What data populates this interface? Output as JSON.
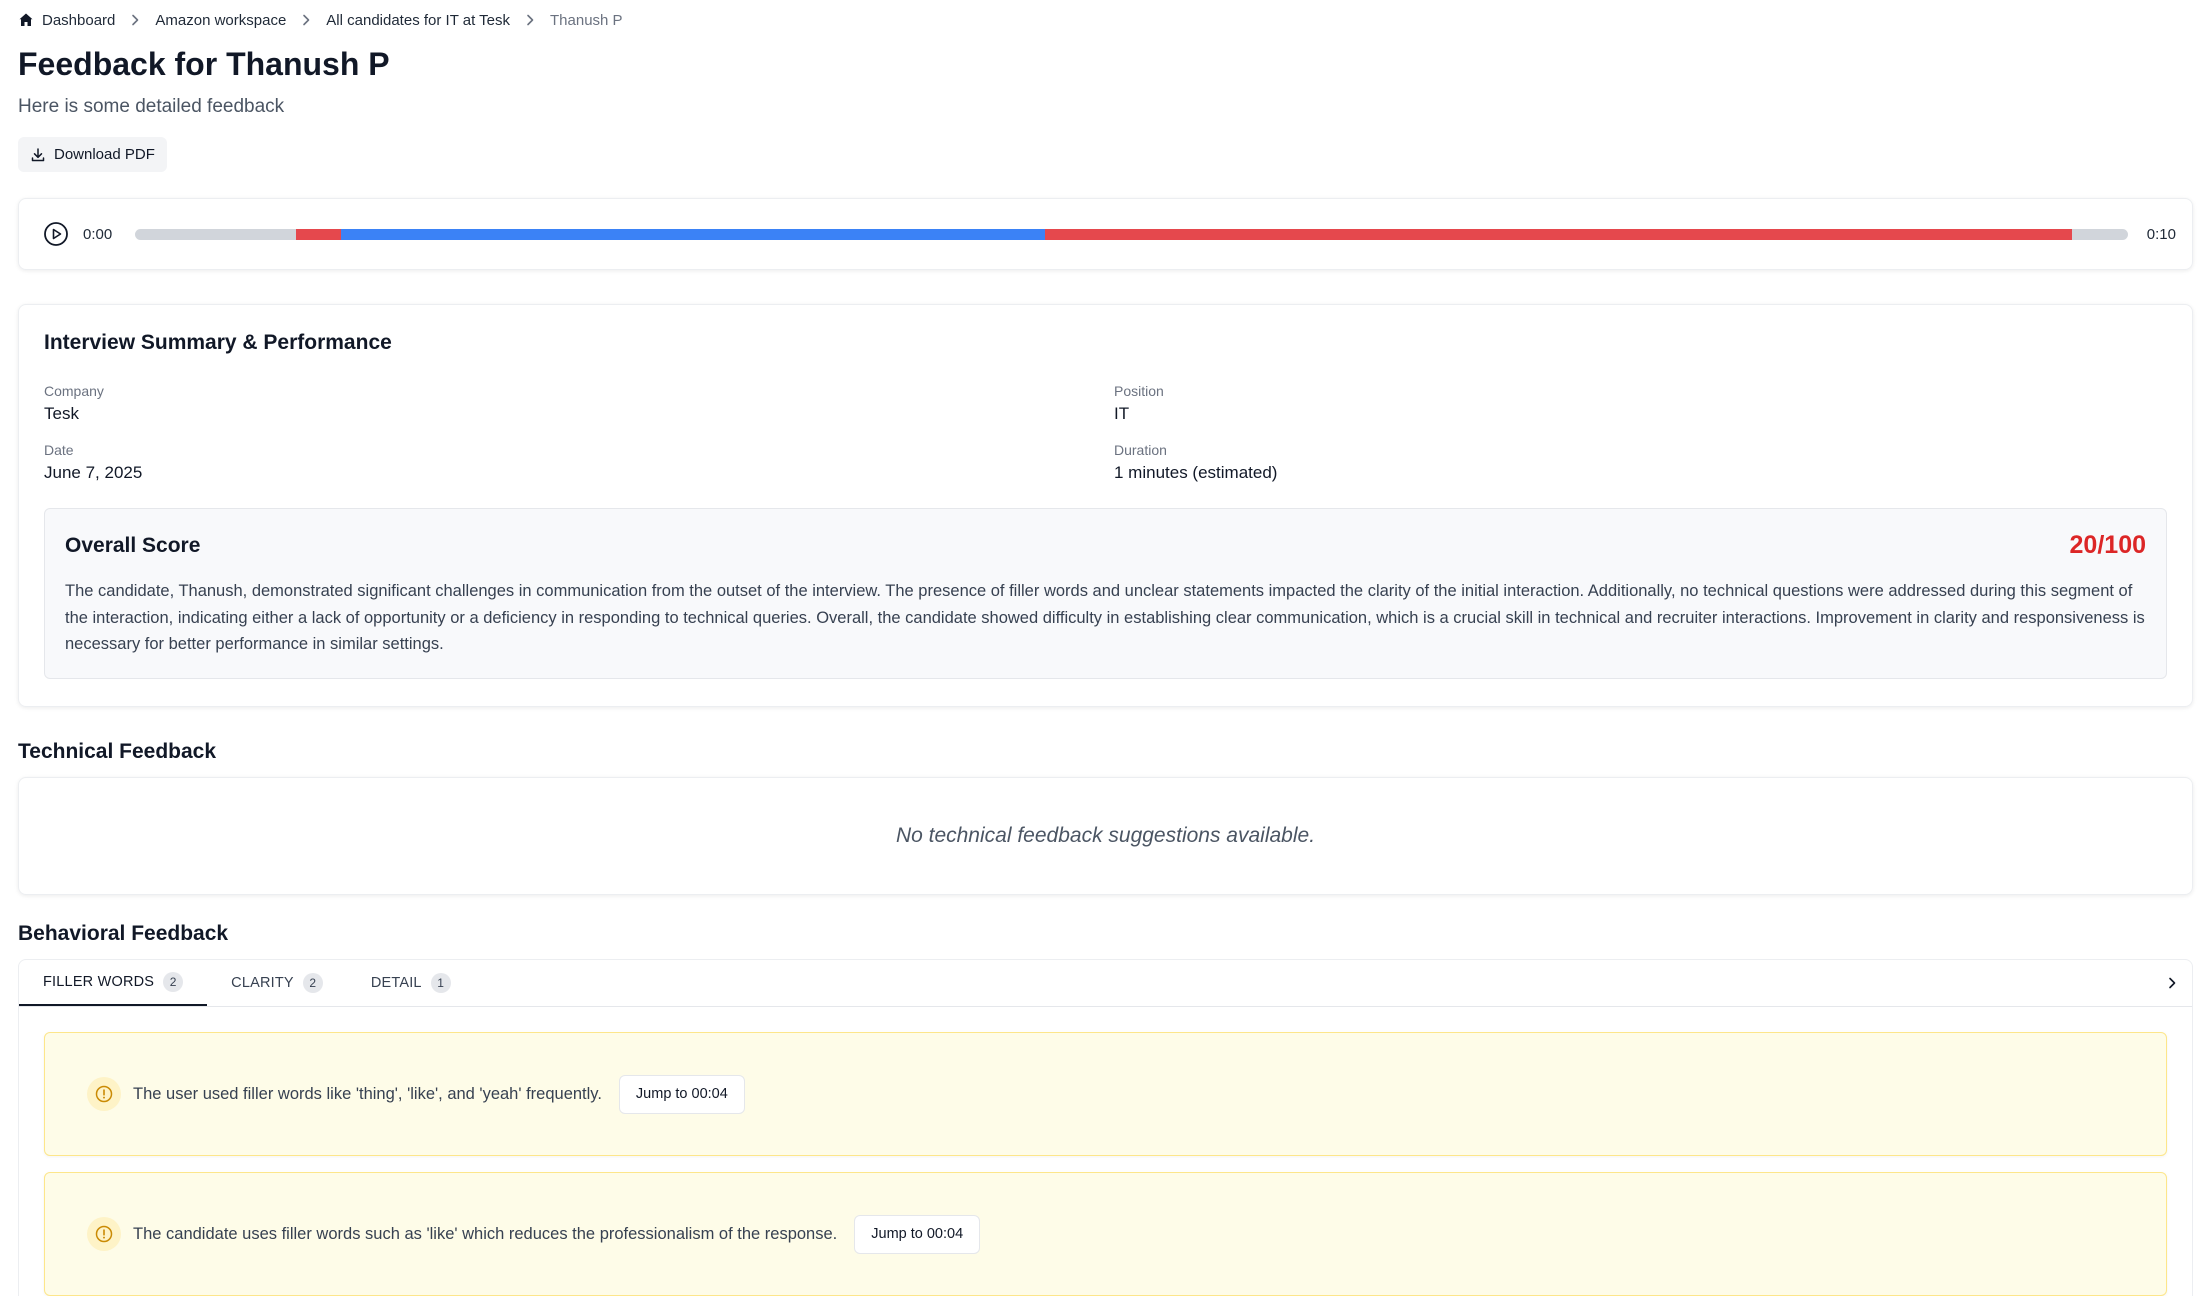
{
  "breadcrumb": {
    "items": [
      "Dashboard",
      "Amazon workspace",
      "All candidates for IT at Tesk"
    ],
    "current": "Thanush P"
  },
  "page": {
    "title": "Feedback for Thanush P",
    "subtitle": "Here is some detailed feedback",
    "download_label": "Download PDF"
  },
  "player": {
    "current_time": "0:00",
    "end_time": "0:10",
    "segments": [
      {
        "start": 0.0806,
        "end": 0.1036,
        "color": "#e5484d"
      },
      {
        "start": 0.1036,
        "end": 0.4566,
        "color": "#3b82f6"
      },
      {
        "start": 0.4566,
        "end": 0.9717,
        "color": "#e5484d"
      }
    ]
  },
  "summary": {
    "title": "Interview Summary & Performance",
    "company_label": "Company",
    "company": "Tesk",
    "position_label": "Position",
    "position": "IT",
    "date_label": "Date",
    "date": "June 7, 2025",
    "duration_label": "Duration",
    "duration": "1 minutes (estimated)",
    "score_title": "Overall Score",
    "score": "20/100",
    "score_color": "#dc2626",
    "score_text": "The candidate, Thanush, demonstrated significant challenges in communication from the outset of the interview. The presence of filler words and unclear statements impacted the clarity of the initial interaction. Additionally, no technical questions were addressed during this segment of the interaction, indicating either a lack of opportunity or a deficiency in responding to technical queries. Overall, the candidate showed difficulty in establishing clear communication, which is a crucial skill in technical and recruiter interactions. Improvement in clarity and responsiveness is necessary for better performance in similar settings."
  },
  "technical": {
    "title": "Technical Feedback",
    "empty_text": "No technical feedback suggestions available."
  },
  "behavioral": {
    "title": "Behavioral Feedback",
    "tabs": [
      {
        "label": "FILLER WORDS",
        "count": "2"
      },
      {
        "label": "CLARITY",
        "count": "2"
      },
      {
        "label": "DETAIL",
        "count": "1"
      }
    ],
    "items": [
      {
        "text": "The user used filler words like 'thing', 'like', and 'yeah' frequently.",
        "jump_label": "Jump to 00:04"
      },
      {
        "text": "The candidate uses filler words such as 'like' which reduces the professionalism of the response.",
        "jump_label": "Jump to 00:04"
      }
    ]
  }
}
